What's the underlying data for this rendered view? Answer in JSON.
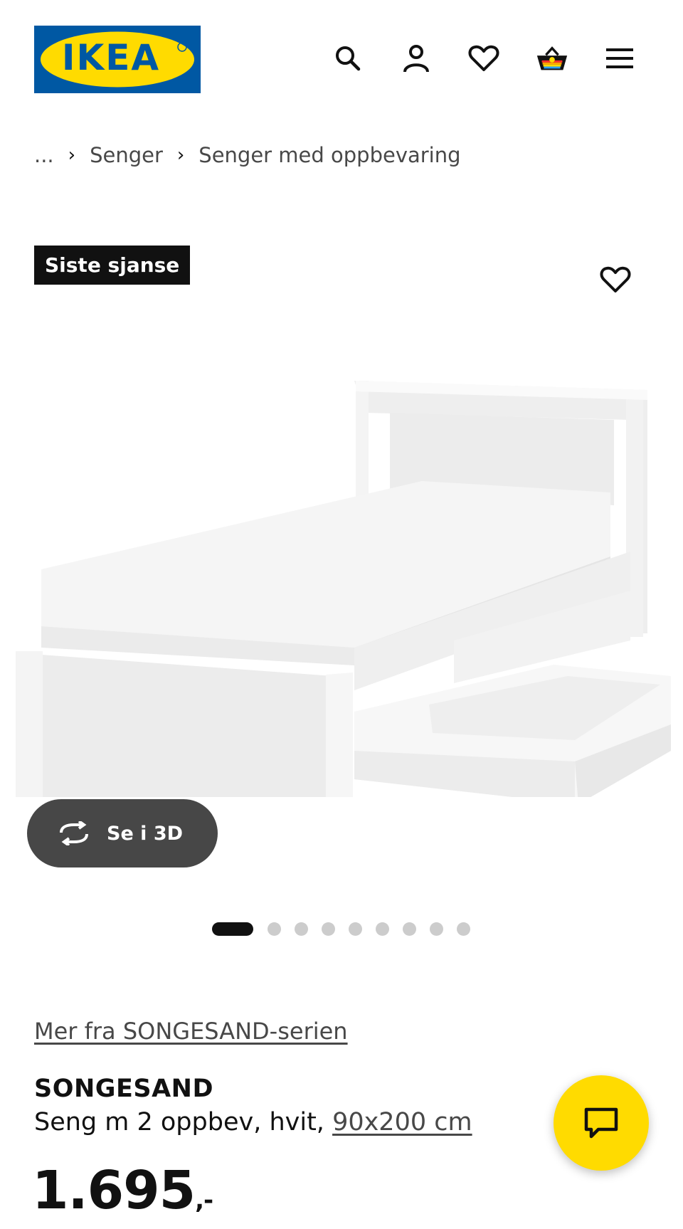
{
  "header": {
    "logo_text": "IKEA",
    "logo_mark": "®",
    "icons": [
      "search-icon",
      "account-icon",
      "heart-icon",
      "basket-icon",
      "menu-icon"
    ]
  },
  "breadcrumb": {
    "ellipsis": "...",
    "items": [
      "Senger",
      "Senger med oppbevaring"
    ]
  },
  "gallery": {
    "badge": "Siste sjanse",
    "view_3d_label": "Se i 3D",
    "image_count": 9,
    "active_image": 1
  },
  "product": {
    "series_link": "Mer fra SONGESAND-serien",
    "name": "SONGESAND",
    "description": "Seng m 2 oppbev, hvit,",
    "size": "90x200 cm",
    "price": "1.695",
    "price_suffix": ",-"
  },
  "colors": {
    "brand_blue": "#0058a3",
    "brand_yellow": "#ffdb00",
    "badge_bg": "#111111",
    "button_dark": "#474747"
  }
}
